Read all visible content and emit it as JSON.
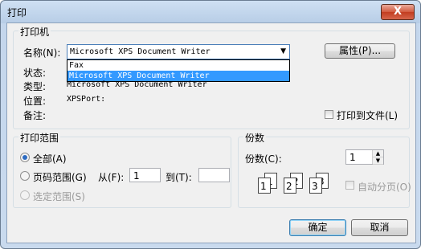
{
  "window": {
    "title": "打印",
    "close_label": "X"
  },
  "printer": {
    "group_label": "打印机",
    "name_label": "名称(N):",
    "selected": "Microsoft XPS Document Writer",
    "options": [
      "Fax",
      "Microsoft XPS Document Writer"
    ],
    "properties_button": "属性(P)...",
    "status_label": "状态:",
    "type_label": "类型:",
    "type_value": "Microsoft XPS Document Writer",
    "where_label": "位置:",
    "where_value": "XPSPort:",
    "comment_label": "备注:",
    "print_to_file_label": "打印到文件(L)"
  },
  "range": {
    "group_label": "打印范围",
    "all_label": "全部(A)",
    "pages_label": "页码范围(G)",
    "from_label": "从(F):",
    "from_value": "1",
    "to_label": "到(T):",
    "to_value": "",
    "selection_label": "选定范围(S)"
  },
  "copies": {
    "group_label": "份数",
    "count_label": "份数(C):",
    "count_value": "1",
    "collate_label": "自动分页(O)",
    "collate_pages": [
      "1",
      "1",
      "2",
      "2",
      "3",
      "3"
    ]
  },
  "buttons": {
    "ok": "确定",
    "cancel": "取消"
  }
}
